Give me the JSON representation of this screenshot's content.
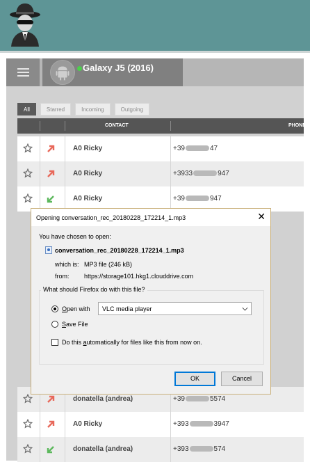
{
  "colors": {
    "banner": "#5e9596",
    "online": "#4ccf4c",
    "outgoing": "#e8685a",
    "incoming": "#5cb85c",
    "focus": "#0078d7"
  },
  "header": {
    "logo_icon": "spy-avatar-icon"
  },
  "device": {
    "name": "Galaxy J5 (2016)",
    "status": "online",
    "icon": "android-icon"
  },
  "filters": [
    {
      "label": "All",
      "active": true
    },
    {
      "label": "Starred",
      "active": false
    },
    {
      "label": "Incoming",
      "active": false
    },
    {
      "label": "Outgoing",
      "active": false
    }
  ],
  "table": {
    "columns": [
      "CONTACT",
      "PHONE"
    ],
    "rows": [
      {
        "direction": "outgoing",
        "contact": "A0 Ricky",
        "phone_prefix": "+39",
        "phone_suffix": "47"
      },
      {
        "direction": "outgoing",
        "contact": "A0 Ricky",
        "phone_prefix": "+3933",
        "phone_suffix": "947"
      },
      {
        "direction": "incoming",
        "contact": "A0 Ricky",
        "phone_prefix": "+39",
        "phone_suffix": "947"
      },
      {
        "direction": "outgoing",
        "contact": "donatella (andrea)",
        "phone_prefix": "+39",
        "phone_suffix": "5574"
      },
      {
        "direction": "outgoing",
        "contact": "A0 Ricky",
        "phone_prefix": "+393",
        "phone_suffix": "3947"
      },
      {
        "direction": "incoming",
        "contact": "donatella (andrea)",
        "phone_prefix": "+393",
        "phone_suffix": "574"
      }
    ]
  },
  "dialog": {
    "title": "Opening conversation_rec_20180228_172214_1.mp3",
    "chosen_text": "You have chosen to open:",
    "file_name": "conversation_rec_20180228_172214_1.mp3",
    "which_is_label": "which is:",
    "which_is_value": "MP3 file (246 kB)",
    "from_label": "from:",
    "from_value": "https://storage101.hkg1.clouddrive.com",
    "question": "What should Firefox do with this file?",
    "open_with_key": "O",
    "open_with_rest": "pen with",
    "app": "VLC media player",
    "save_key": "S",
    "save_rest": "ave File",
    "auto_pre": "Do this ",
    "auto_key": "a",
    "auto_post": "utomatically for files like this from now on.",
    "ok_label": "OK",
    "cancel_label": "Cancel",
    "selected_option": "open_with",
    "auto_checked": false
  }
}
